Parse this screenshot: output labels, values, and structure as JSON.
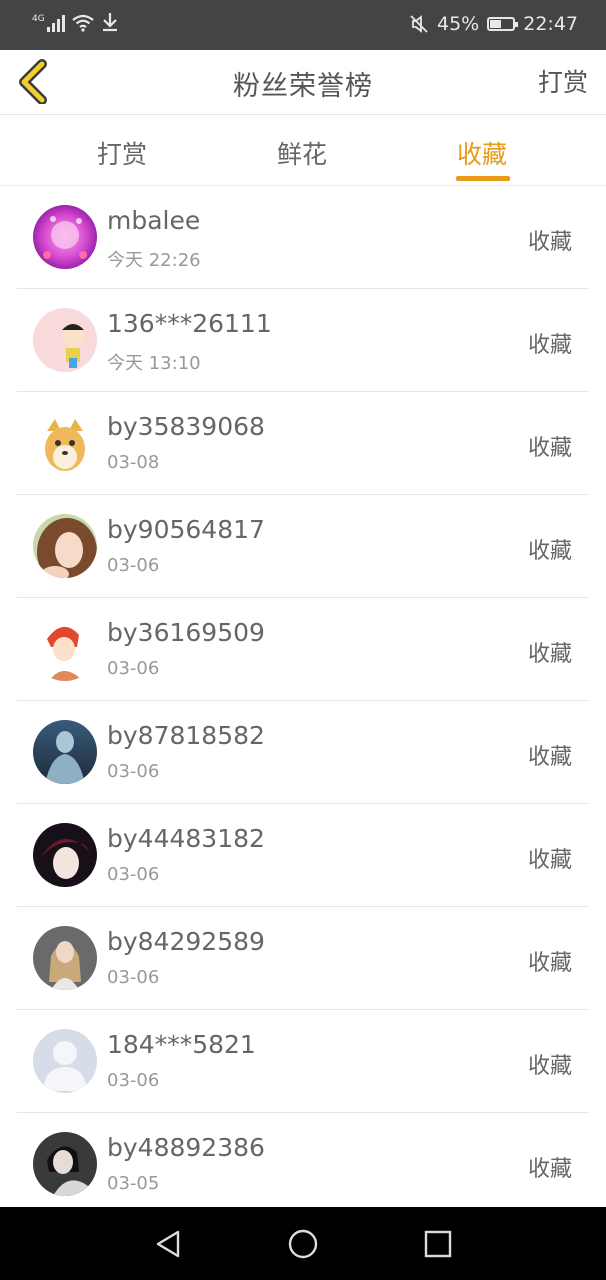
{
  "status_bar": {
    "network": "4G",
    "battery": "45%",
    "time": "22:47"
  },
  "header": {
    "title": "粉丝荣誉榜",
    "action": "打赏"
  },
  "tabs": [
    {
      "label": "打赏",
      "active": false
    },
    {
      "label": "鲜花",
      "active": false
    },
    {
      "label": "收藏",
      "active": true
    }
  ],
  "accent_color": "#e99b17",
  "fans": [
    {
      "name": "mbalee",
      "time": "今天 22:26",
      "action": "收藏"
    },
    {
      "name": "136***26111",
      "time": "今天 13:10",
      "action": "收藏"
    },
    {
      "name": "by35839068",
      "time": "03-08",
      "action": "收藏"
    },
    {
      "name": "by90564817",
      "time": "03-06",
      "action": "收藏"
    },
    {
      "name": "by36169509",
      "time": "03-06",
      "action": "收藏"
    },
    {
      "name": "by87818582",
      "time": "03-06",
      "action": "收藏"
    },
    {
      "name": "by44483182",
      "time": "03-06",
      "action": "收藏"
    },
    {
      "name": "by84292589",
      "time": "03-06",
      "action": "收藏"
    },
    {
      "name": "184***5821",
      "time": "03-06",
      "action": "收藏"
    },
    {
      "name": "by48892386",
      "time": "03-05",
      "action": "收藏"
    }
  ]
}
